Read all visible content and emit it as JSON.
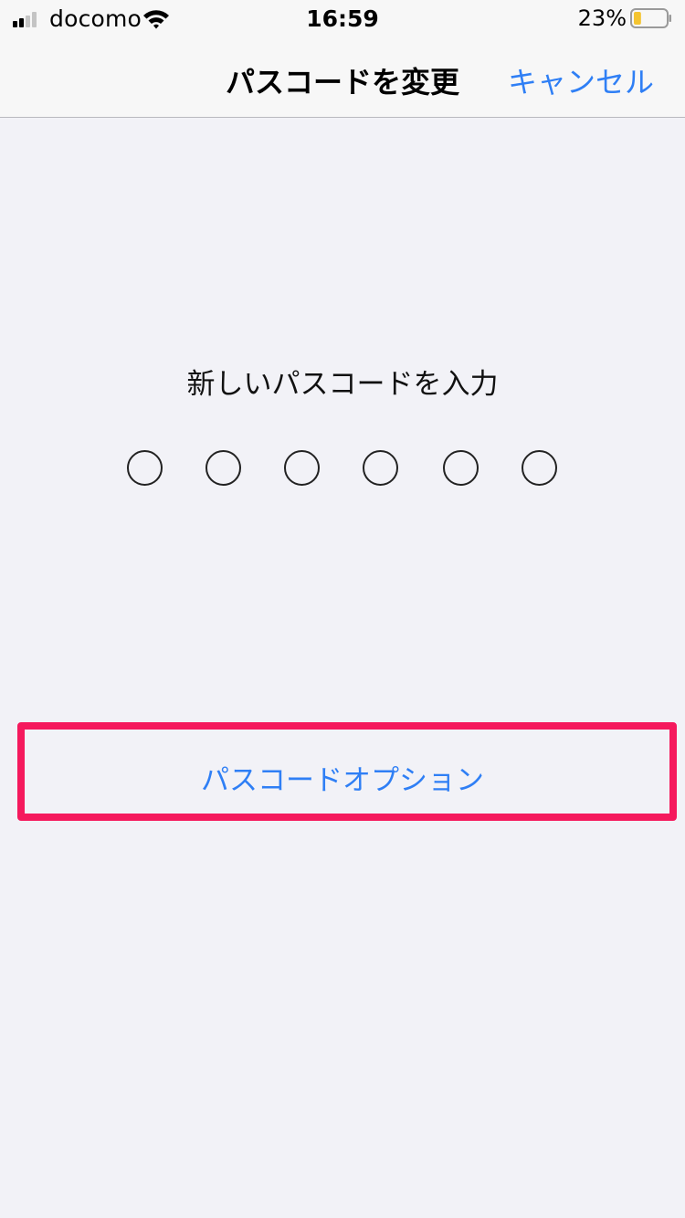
{
  "status_bar": {
    "carrier": "docomo",
    "time": "16:59",
    "battery_percent": "23%",
    "signal_bars_total": 4,
    "signal_bars_active": 2,
    "battery_level": 0.23,
    "battery_color": "#f4c430"
  },
  "nav": {
    "title": "パスコードを変更",
    "cancel_label": "キャンセル"
  },
  "passcode": {
    "prompt": "新しいパスコードを入力",
    "digit_count": 6,
    "filled_count": 0
  },
  "options": {
    "label": "パスコードオプション"
  },
  "colors": {
    "accent": "#2f7ff5",
    "highlight": "#f5195d",
    "background": "#f2f2f7"
  },
  "icons": [
    "signal-strength-icon",
    "wifi-icon",
    "battery-icon"
  ]
}
